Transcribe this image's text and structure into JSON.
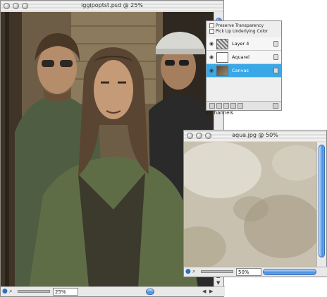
{
  "windows": {
    "main": {
      "title": "iggipoptst.psd @ 25%",
      "zoom": "25%"
    },
    "aqua": {
      "title": "aqua.jpg @ 50%",
      "zoom": "50%"
    }
  },
  "layers_palette": {
    "options": [
      "Preserve Transparency",
      "Pick Up Underlying Color"
    ],
    "layers": [
      {
        "name": "Layer 4",
        "selected": false
      },
      {
        "name": "Aquarel",
        "selected": false
      },
      {
        "name": "Canvas",
        "selected": true
      }
    ],
    "channels_label": "Channels",
    "accent_color": "#3aa7e6"
  },
  "icons": {
    "visibility": "eye-icon",
    "lock": "lock-icon",
    "trash": "trash-icon",
    "zoom": "zoom-icon",
    "info": "info-icon"
  }
}
